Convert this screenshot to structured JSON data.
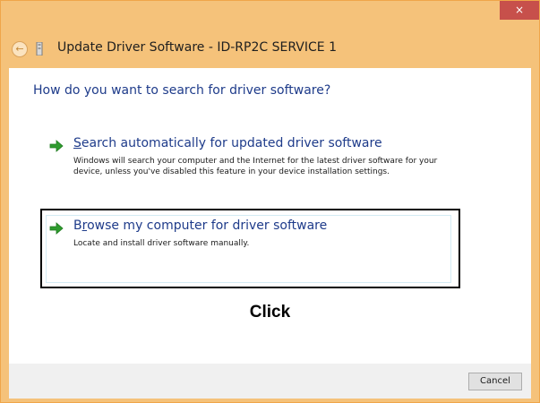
{
  "window": {
    "close_label": "×"
  },
  "navbar": {
    "back_icon_glyph": "←",
    "title": "Update Driver Software - ID-RP2C SERVICE 1"
  },
  "content": {
    "heading": "How do you want to search for driver software?",
    "options": [
      {
        "accel": "S",
        "title_rest": "earch automatically for updated driver software",
        "description": "Windows will search your computer and the Internet for the latest driver software for your device, unless you've disabled this feature in your device installation settings.",
        "icon": "green-arrow-icon"
      },
      {
        "title_first": "B",
        "accel": "r",
        "title_rest": "owse my computer for driver software",
        "description": "Locate and install driver software manually.",
        "icon": "green-arrow-icon"
      }
    ],
    "annotation_label": "Click"
  },
  "footer": {
    "cancel_label": "Cancel"
  },
  "colors": {
    "title_bar": "#f5c27a",
    "close_button": "#c7504b",
    "link_blue": "#1e3b8a",
    "arrow_green": "#2e9b2e",
    "footer_bg": "#f0f0f0"
  }
}
